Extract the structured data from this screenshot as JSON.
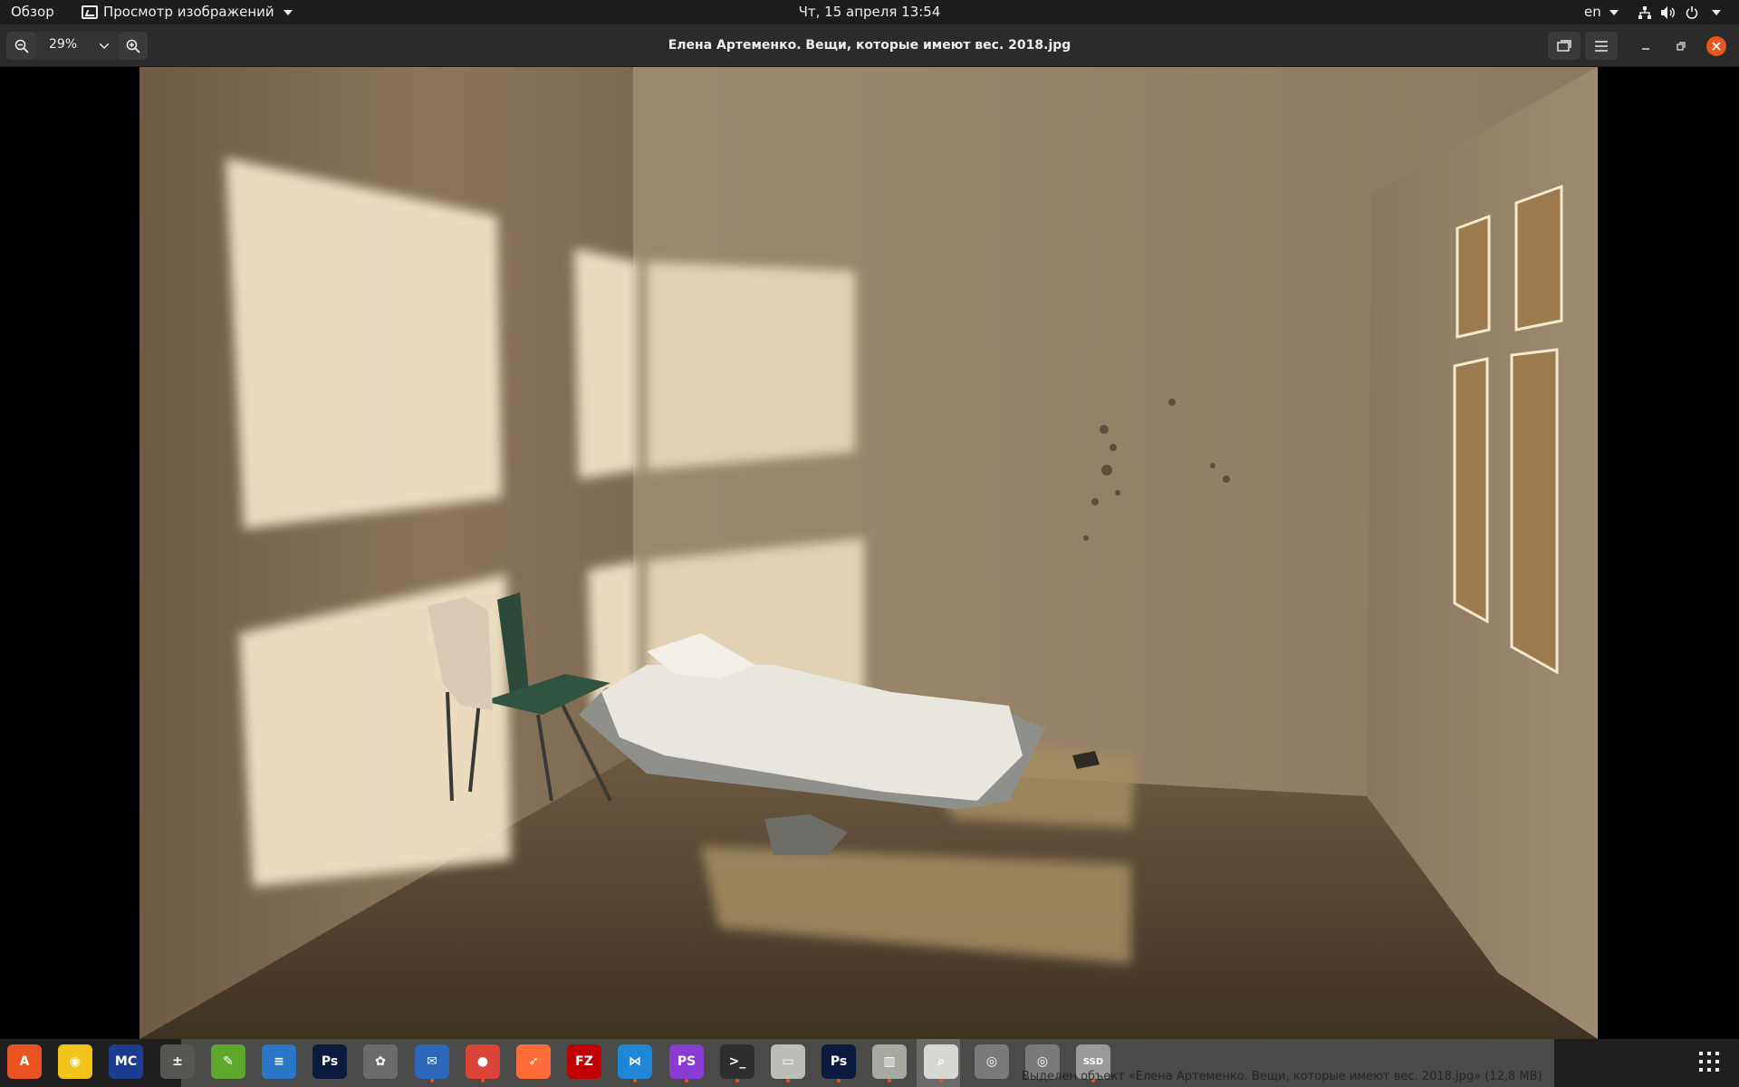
{
  "topbar": {
    "activities": "Обзор",
    "app_menu_label": "Просмотр изображений",
    "app_menu_icon": "image-viewer-icon",
    "clock": "Чт, 15 апреля  13:54",
    "language": "en",
    "status_icons": [
      "network-icon",
      "volume-icon",
      "power-icon"
    ]
  },
  "headerbar": {
    "zoom_value": "29%",
    "title": "Елена Артеменко. Вещи, которые имеют вес. 2018.jpg"
  },
  "image": {
    "description_icon": "room-photo"
  },
  "dock": {
    "notification": "Выделен объект «Елена Артеменко. Вещи, которые имеют вес. 2018.jpg» (12,8 MB)",
    "items": [
      {
        "name": "ubuntu-software-icon",
        "glyph": "A",
        "bg": "#e95420",
        "running": false
      },
      {
        "name": "rhythmbox-icon",
        "glyph": "◉",
        "bg": "#f2c318",
        "running": false
      },
      {
        "name": "midnight-commander-icon",
        "glyph": "MC",
        "bg": "#1c3d8f",
        "running": false
      },
      {
        "name": "calculator-icon",
        "glyph": "±",
        "bg": "#555753",
        "running": false
      },
      {
        "name": "leafpad-icon",
        "glyph": "✎",
        "bg": "#5fa82b",
        "running": false
      },
      {
        "name": "libreoffice-writer-icon",
        "glyph": "≡",
        "bg": "#2a77c8",
        "running": false
      },
      {
        "name": "photoshop-icon",
        "glyph": "Ps",
        "bg": "#0b1b3f",
        "running": false
      },
      {
        "name": "gimp-icon",
        "glyph": "✿",
        "bg": "#6b6b6b",
        "running": false
      },
      {
        "name": "thunderbird-icon",
        "glyph": "✉",
        "bg": "#2b66b8",
        "running": true
      },
      {
        "name": "chrome-icon",
        "glyph": "●",
        "bg": "#db4437",
        "running": true
      },
      {
        "name": "postman-icon",
        "glyph": "➶",
        "bg": "#ff6c37",
        "running": false
      },
      {
        "name": "filezilla-icon",
        "glyph": "FZ",
        "bg": "#bf0000",
        "running": false
      },
      {
        "name": "vscode-icon",
        "glyph": "⋈",
        "bg": "#1e88d6",
        "running": true
      },
      {
        "name": "phpstorm-icon",
        "glyph": "PS",
        "bg": "#8a3bd1",
        "running": true
      },
      {
        "name": "terminal-icon",
        "glyph": ">_",
        "bg": "#2e2e2e",
        "running": true
      },
      {
        "name": "files-icon",
        "glyph": "▭",
        "bg": "#bdbdb8",
        "running": true
      },
      {
        "name": "photoshop-2-icon",
        "glyph": "Ps",
        "bg": "#0b1b3f",
        "running": true
      },
      {
        "name": "archive-manager-icon",
        "glyph": "▥",
        "bg": "#a8a8a0",
        "running": true
      },
      {
        "name": "image-viewer-icon",
        "glyph": "⌕",
        "bg": "#d6d6d2",
        "running": true
      },
      {
        "name": "disk-1-icon",
        "glyph": "◎",
        "bg": "#7a7a78",
        "running": false
      },
      {
        "name": "disk-2-icon",
        "glyph": "◎",
        "bg": "#7a7a78",
        "running": false
      },
      {
        "name": "ssd-drive-icon",
        "glyph": "SSD",
        "bg": "#9a9a98",
        "running": true
      }
    ]
  }
}
